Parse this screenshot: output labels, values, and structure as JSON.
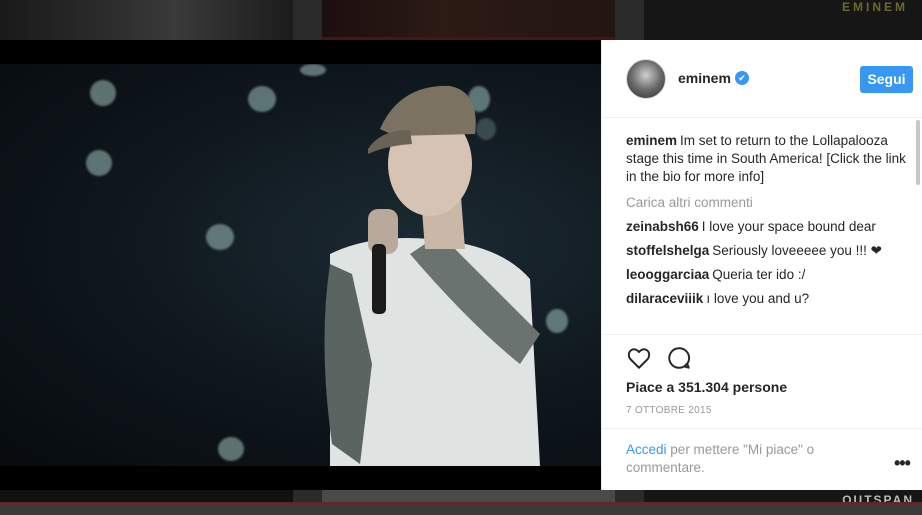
{
  "background": {
    "top_right_text": "EMINEM",
    "bottom_right_text": "OUTSPAN"
  },
  "post": {
    "username": "eminem",
    "verified_badge": "✔",
    "follow_label": "Segui",
    "caption_user": "eminem",
    "caption_text": "Im set to return to the Lollapalooza stage this time in South America! [Click the link in the bio for more info]",
    "load_more_label": "Carica altri commenti",
    "comments": [
      {
        "user": "zeinabsh66",
        "text": "I love your space bound dear"
      },
      {
        "user": "stoffelshelga",
        "text": "Seriously loveeeee you !!! ❤"
      },
      {
        "user": "leooggarciaa",
        "text": "Queria ter ido :/"
      },
      {
        "user": "dilaraceviiik",
        "text": "ı love you and u?"
      }
    ],
    "likes_text": "Piace a 351.304 persone",
    "date_text": "7 ottobre 2015",
    "login_link": "Accedi",
    "login_rest": "per mettere \"Mi piace\" o commentare.",
    "more_label": "•••"
  },
  "icons": {
    "like": "heart-icon",
    "comment": "comment-icon",
    "verified": "verified-badge-icon",
    "more": "more-options-icon"
  },
  "colors": {
    "accent": "#3897f0",
    "muted": "#999999",
    "text": "#262626"
  }
}
